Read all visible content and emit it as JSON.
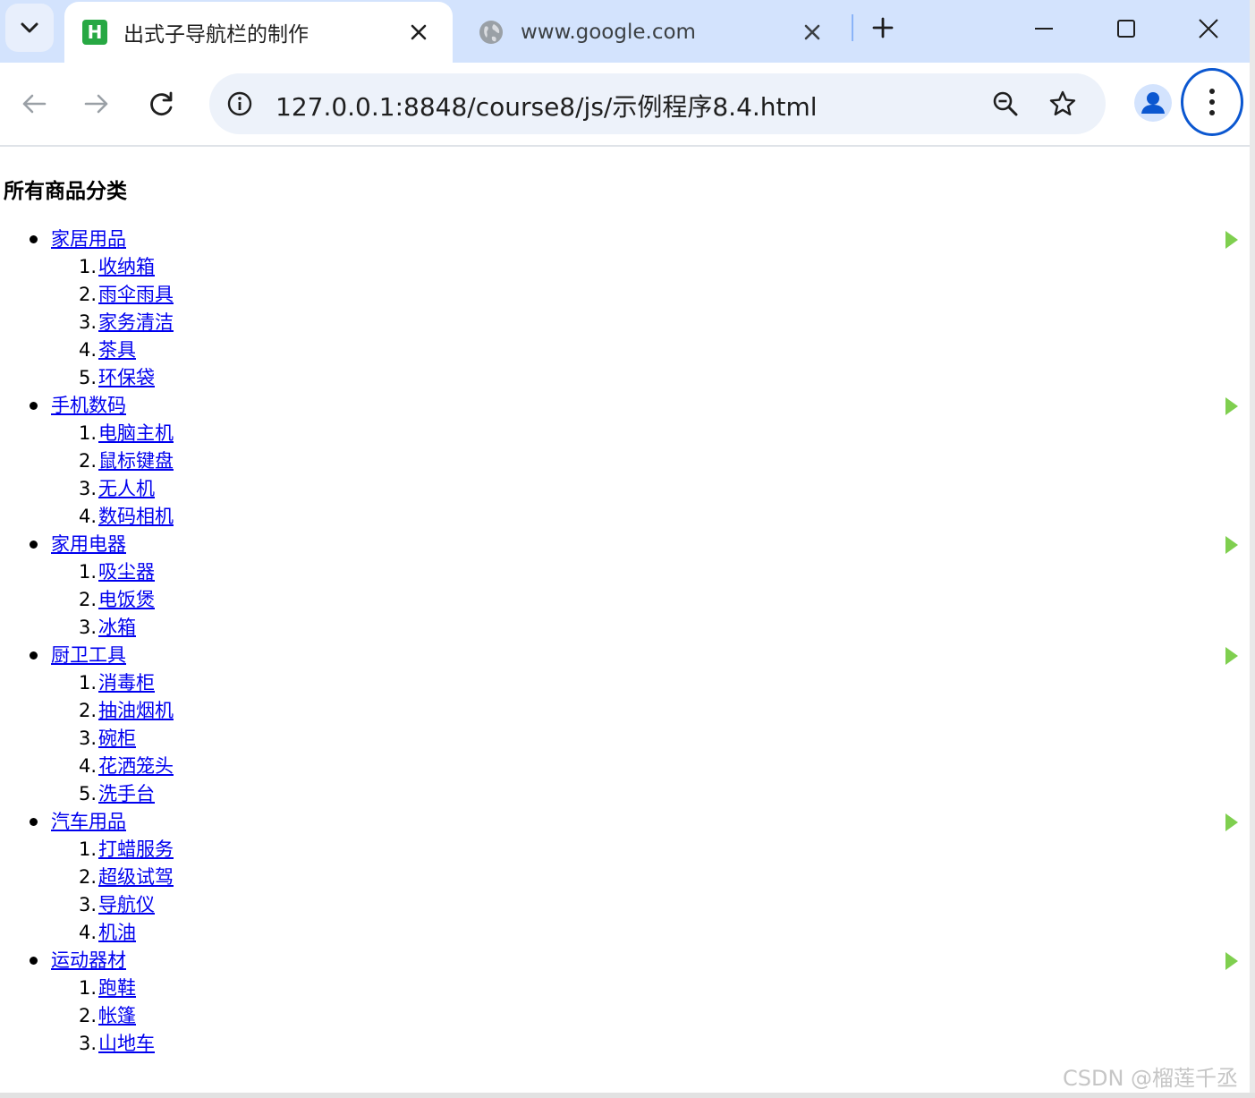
{
  "browser": {
    "tabs": [
      {
        "title": "出式子导航栏的制作",
        "active": true,
        "favicon": "hbuilder-icon",
        "favicon_text": "H"
      },
      {
        "title": "www.google.com",
        "active": false,
        "favicon": "globe-icon"
      }
    ],
    "url": "127.0.0.1:8848/course8/js/示例程序8.4.html"
  },
  "page": {
    "heading": "所有商品分类",
    "categories": [
      {
        "name": "家居用品",
        "items": [
          "收纳箱",
          "雨伞雨具",
          "家务清洁",
          "茶具",
          "环保袋"
        ]
      },
      {
        "name": "手机数码",
        "items": [
          "电脑主机",
          "鼠标键盘",
          "无人机",
          "数码相机"
        ]
      },
      {
        "name": "家用电器",
        "items": [
          "吸尘器",
          "电饭煲",
          "冰箱"
        ]
      },
      {
        "name": "厨卫工具",
        "items": [
          "消毒柜",
          "抽油烟机",
          "碗柜",
          "花洒笼头",
          "洗手台"
        ]
      },
      {
        "name": "汽车用品",
        "items": [
          "打蜡服务",
          "超级试驾",
          "导航仪",
          "机油"
        ]
      },
      {
        "name": "运动器材",
        "items": [
          "跑鞋",
          "帐篷",
          "山地车"
        ]
      }
    ],
    "arrow_color": "#7fcf4f",
    "link_color": "#0000ee"
  },
  "watermark": "CSDN @榴莲千丞"
}
